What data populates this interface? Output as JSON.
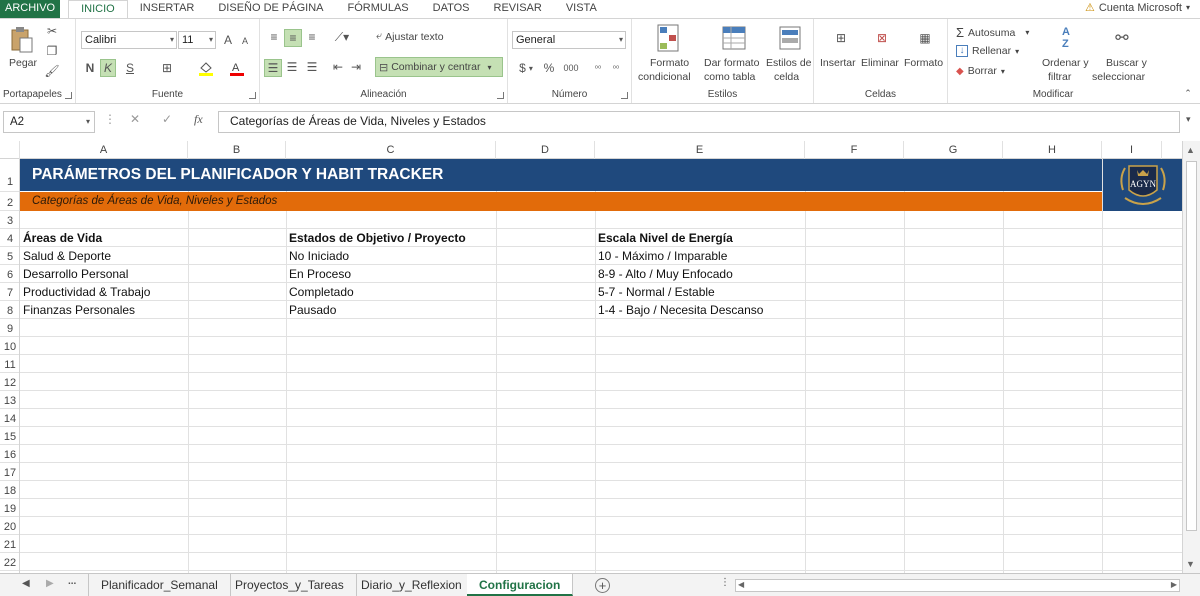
{
  "tabs": {
    "file": "ARCHIVO",
    "items": [
      "INICIO",
      "INSERTAR",
      "DISEÑO DE PÁGINA",
      "FÓRMULAS",
      "DATOS",
      "REVISAR",
      "VISTA"
    ],
    "active": "INICIO"
  },
  "account": {
    "label": "Cuenta Microsoft"
  },
  "ribbon": {
    "clipboard": {
      "paste": "Pegar",
      "group": "Portapapeles"
    },
    "font": {
      "name": "Calibri",
      "size": "11",
      "bold": "N",
      "italic": "K",
      "underline": "S",
      "grow": "A",
      "shrink": "A",
      "group": "Fuente"
    },
    "alignment": {
      "wrap": "Ajustar texto",
      "merge": "Combinar y centrar",
      "group": "Alineación"
    },
    "number": {
      "format": "General",
      "currency": "$",
      "percent": "%",
      "thousands": "000",
      "group": "Número"
    },
    "styles": {
      "conditional": [
        "Formato",
        "condicional"
      ],
      "table": [
        "Dar formato",
        "como tabla"
      ],
      "cell": [
        "Estilos de",
        "celda"
      ],
      "group": "Estilos"
    },
    "cells": {
      "insert": "Insertar",
      "delete": "Eliminar",
      "format": "Formato",
      "group": "Celdas"
    },
    "editing": {
      "autosum": "Autosuma",
      "fill": "Rellenar",
      "clear": "Borrar",
      "sort": [
        "Ordenar y",
        "filtrar"
      ],
      "find": [
        "Buscar y",
        "seleccionar"
      ],
      "group": "Modificar"
    }
  },
  "formula_bar": {
    "cell_ref": "A2",
    "fx": "fx",
    "content": "Categorías de Áreas de Vida, Niveles y Estados"
  },
  "columns": [
    "A",
    "B",
    "C",
    "D",
    "E",
    "F",
    "G",
    "H",
    "I"
  ],
  "rows": [
    "1",
    "2",
    "3",
    "4",
    "5",
    "6",
    "7",
    "8",
    "9",
    "10",
    "11",
    "12",
    "13",
    "14",
    "15",
    "16",
    "17",
    "18",
    "19",
    "20",
    "21",
    "22"
  ],
  "sheet": {
    "title": "PARÁMETROS DEL PLANIFICADOR Y HABIT TRACKER",
    "subtitle": "Categorías de Áreas de Vida, Niveles y Estados",
    "logo_text": "AGYN",
    "areas": {
      "header": "Áreas de Vida",
      "items": [
        "Salud & Deporte",
        "Desarrollo Personal",
        "Productividad & Trabajo",
        "Finanzas Personales"
      ]
    },
    "states": {
      "header": "Estados de Objetivo / Proyecto",
      "items": [
        "No Iniciado",
        "En Proceso",
        "Completado",
        "Pausado"
      ]
    },
    "energy": {
      "header": "Escala Nivel de Energía",
      "items": [
        "10 - Máximo / Imparable",
        "8-9 - Alto / Muy Enfocado",
        "5-7 - Normal / Estable",
        "1-4 - Bajo / Necesita Descanso"
      ]
    }
  },
  "sheet_tabs": {
    "more": "...",
    "items": [
      "Planificador_Semanal",
      "Proyectos_y_Tareas",
      "Diario_y_Reflexion",
      "Configuracion"
    ],
    "active": "Configuracion",
    "add": "+"
  },
  "colors": {
    "accent": "#217346",
    "title_bg": "#1f497d",
    "subtitle_bg": "#e26b0a"
  }
}
